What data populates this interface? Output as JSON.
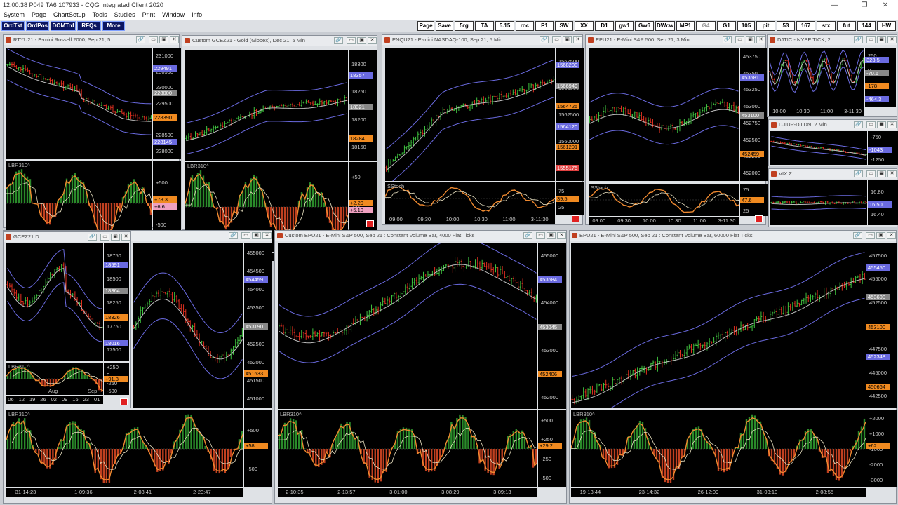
{
  "app": {
    "title": "12:00:38  P049 TA6  107933 - CQG Integrated Client 2020"
  },
  "menu": [
    "System",
    "Page",
    "ChartSetup",
    "Tools",
    "Studies",
    "Print",
    "Window",
    "Info"
  ],
  "quick_buttons": [
    "OrdTkt",
    "OrdPos",
    "DOMTrd",
    "RFQs",
    "More"
  ],
  "toolbar_buttons": [
    "Page",
    "Save",
    "5rg",
    "TA",
    "5.15",
    "roc",
    "P1",
    "SW",
    "XX",
    "D1",
    "gw1",
    "Gw6",
    "DWcw",
    "MP1",
    "G4",
    "G1",
    "105",
    "pit",
    "53",
    "167",
    "stx",
    "fut",
    "144",
    "HW"
  ],
  "windows": {
    "rty": {
      "title": "RTYU21 - E-mini Russell 2000, Sep 21, 5 ...",
      "yticks": [
        "231000",
        "230500",
        "230000",
        "229500",
        "229000",
        "228500",
        "228000"
      ],
      "tags": [
        "229491",
        "228000",
        "228390",
        "228145"
      ],
      "ind": "LBR310^",
      "ind_ticks": [
        "+500",
        "-500"
      ],
      "ind_tags": [
        "+78.3",
        "+6.6"
      ],
      "x": [
        "05:00",
        "07:00",
        "3-08:30",
        "3-10:00",
        "3-11:30"
      ]
    },
    "gc": {
      "title": "Custom GCEZ21 - Gold (Globex), Dec 21, 5 Min",
      "yticks": [
        "18300",
        "18250",
        "18200",
        "18150"
      ],
      "tags": [
        "18357",
        "18321",
        "18284"
      ],
      "ind": "LBR310^",
      "ind_ticks": [
        "+50",
        "+25",
        "-25"
      ],
      "ind_tags": [
        "+2.20",
        "+5.10"
      ],
      "x": [
        "3-07:00",
        "08:00",
        "09:00",
        "10:00",
        "3-11:00"
      ]
    },
    "enq": {
      "title": "ENQU21 - E-mini NASDAQ-100, Sep 21, 5 Min",
      "yticks": [
        "1567500",
        "1565000",
        "1562500",
        "1560000",
        "1557500"
      ],
      "tags": [
        "1568200",
        "1566949",
        "1564725",
        "1564120",
        "1561291",
        "1555175"
      ],
      "ind": "SStoch",
      "ind_ticks": [
        "75",
        "25"
      ],
      "ind_tags": [
        "39.5"
      ],
      "x": [
        "09:00",
        "09:30",
        "10:00",
        "10:30",
        "11:00",
        "3-11:30"
      ]
    },
    "ep3": {
      "title": "EPU21 - E-Mini S&P 500, Sep 21, 3 Min",
      "yticks": [
        "453750",
        "453500",
        "453250",
        "453000",
        "452750",
        "452500",
        "452250",
        "452000"
      ],
      "tags": [
        "453681",
        "453100",
        "452459"
      ],
      "ind": "SStoch",
      "ind_ticks": [
        "75",
        "50",
        "25"
      ],
      "ind_tags": [
        "47.6"
      ],
      "x": [
        "09:00",
        "09:30",
        "10:00",
        "10:30",
        "11:00",
        "3-11:30"
      ]
    },
    "ditic": {
      "title": "DJTIC - NYSE TICK, 2 ...",
      "yticks": [
        "250",
        "0",
        "-250",
        "-500"
      ],
      "tags": [
        "323.5",
        "-70.6",
        "-178",
        "-464.3"
      ],
      "x": [
        "10:00",
        "10:30",
        "11:00",
        "3-11:30"
      ]
    },
    "djiup": {
      "title": "DJIUP-DJIDN, 2 Min",
      "yticks": [
        "-750",
        "-1000",
        "-1250"
      ],
      "tags": [
        "-1043"
      ]
    },
    "vix": {
      "title": "VIX.Z",
      "yticks": [
        "16.80",
        "16.40"
      ],
      "tags": [
        "16.50"
      ]
    },
    "gcd": {
      "title": "GCEZ21.D",
      "yticks": [
        "18750",
        "18500",
        "18250",
        "17750",
        "17500"
      ],
      "tags": [
        "18591",
        "18364",
        "18326",
        "18016"
      ],
      "ind": "LBR310^",
      "ind_ticks": [
        "+250",
        "0",
        "-250",
        "-500"
      ],
      "ind_tags": [
        "+91.3"
      ],
      "x": [
        "06",
        "12",
        "19",
        "26",
        "02",
        "09",
        "16",
        "23",
        "01"
      ],
      "months": [
        "Aug",
        "Sep"
      ]
    },
    "cvb16": {
      "title": "Custom Volume Bar, 16000 Flat Ticks",
      "yticks": [
        "455000",
        "454500",
        "454000",
        "453500",
        "453000",
        "452500",
        "452000",
        "451500",
        "451000"
      ],
      "tags": [
        "454459",
        "453190",
        "451633"
      ],
      "ind": "LBR310^",
      "ind_ticks": [
        "+500",
        "-500"
      ],
      "ind_tags": [
        "+58"
      ],
      "x": [
        "31-14:23",
        "1-09:36",
        "2-08:41",
        "2-23:47"
      ]
    },
    "ep4k": {
      "title": "Custom EPU21 - E-Mini S&P 500, Sep 21 : Constant Volume Bar, 4000 Flat Ticks",
      "yticks": [
        "455000",
        "454500",
        "454000",
        "453500",
        "453000",
        "452500",
        "452000"
      ],
      "tags": [
        "453684",
        "453045",
        "452406"
      ],
      "ind": "LBR310^",
      "ind_ticks": [
        "+500",
        "+250",
        "-250",
        "-500"
      ],
      "ind_tags": [
        "+29.2"
      ],
      "x": [
        "2-10:35",
        "2-13:57",
        "3-01:00",
        "3-08:29",
        "3-09:13"
      ]
    },
    "ep60k": {
      "title": "EPU21 - E-Mini S&P 500, Sep 21 : Constant Volume Bar, 60000 Flat Ticks",
      "yticks": [
        "457500",
        "455000",
        "452500",
        "450000",
        "447500",
        "445000",
        "442500"
      ],
      "tags": [
        "455450",
        "453600",
        "453100",
        "452348",
        "450664"
      ],
      "ind": "LBR310^",
      "ind_ticks": [
        "+2000",
        "+1000",
        "-1000",
        "-2000",
        "-3000"
      ],
      "ind_tags": [
        "+62"
      ],
      "x": [
        "19-13:44",
        "23-14:32",
        "26-12:09",
        "31-03:10",
        "2-08:55"
      ]
    }
  }
}
